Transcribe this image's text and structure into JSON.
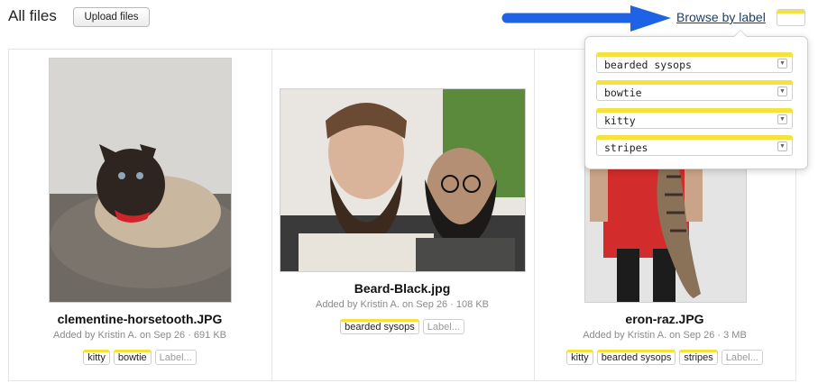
{
  "header": {
    "title": "All files",
    "upload_label": "Upload files",
    "browse_label": "Browse by label"
  },
  "files": [
    {
      "name": "clementine-horsetooth.JPG",
      "meta": "Added by Kristin A. on Sep 26 · 691 KB",
      "labels": [
        "kitty",
        "bowtie"
      ],
      "add_label_placeholder": "Label..."
    },
    {
      "name": "Beard-Black.jpg",
      "meta": "Added by Kristin A. on Sep 26 · 108 KB",
      "labels": [
        "bearded sysops"
      ],
      "add_label_placeholder": "Label..."
    },
    {
      "name": "eron-raz.JPG",
      "meta": "Added by Kristin A. on Sep 26 · 3 MB",
      "labels": [
        "kitty",
        "bearded sysops",
        "stripes"
      ],
      "add_label_placeholder": "Label..."
    }
  ],
  "label_menu": {
    "items": [
      "bearded sysops",
      "bowtie",
      "kitty",
      "stripes"
    ]
  },
  "colors": {
    "label_stripe": "#f5e33c",
    "annotation_arrow": "#1e63e6",
    "link": "#1a3f6b"
  }
}
